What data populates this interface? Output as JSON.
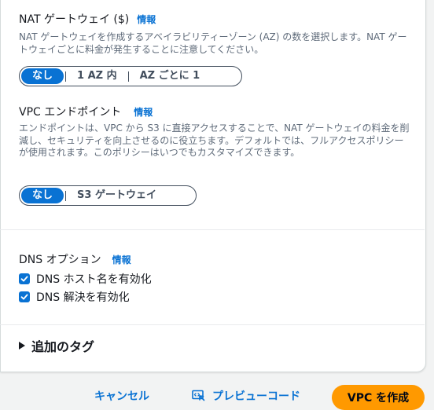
{
  "nat": {
    "title": "NAT ゲートウェイ ($)",
    "info": "情報",
    "description": "NAT ゲートウェイを作成するアベイラビリティーゾーン (AZ) の数を選択します。NAT ゲートウェイごとに料金が発生することに注意してください。",
    "options": [
      "なし",
      "1 AZ 内",
      "AZ ごとに 1"
    ],
    "selected": "なし"
  },
  "endpoint": {
    "title": "VPC エンドポイント",
    "info": "情報",
    "description": "エンドポイントは、VPC から S3 に直接アクセスすることで、NAT ゲートウェイの料金を削減し、セキュリティを向上させるのに役立ちます。デフォルトでは、フルアクセスポリシーが使用されます。このポリシーはいつでもカスタマイズできます。",
    "options": [
      "なし",
      "S3 ゲートウェイ"
    ],
    "selected": "なし"
  },
  "dns": {
    "title": "DNS オプション",
    "info": "情報",
    "hostnames_label": "DNS ホスト名を有効化",
    "hostnames_checked": true,
    "resolution_label": "DNS 解決を有効化",
    "resolution_checked": true
  },
  "tags": {
    "label": "追加のタグ",
    "expanded": false
  },
  "footer": {
    "cancel": "キャンセル",
    "preview": "プレビューコード",
    "create": "VPC を作成"
  },
  "colors": {
    "accent": "#0972d3",
    "primary": "#ff9900"
  }
}
